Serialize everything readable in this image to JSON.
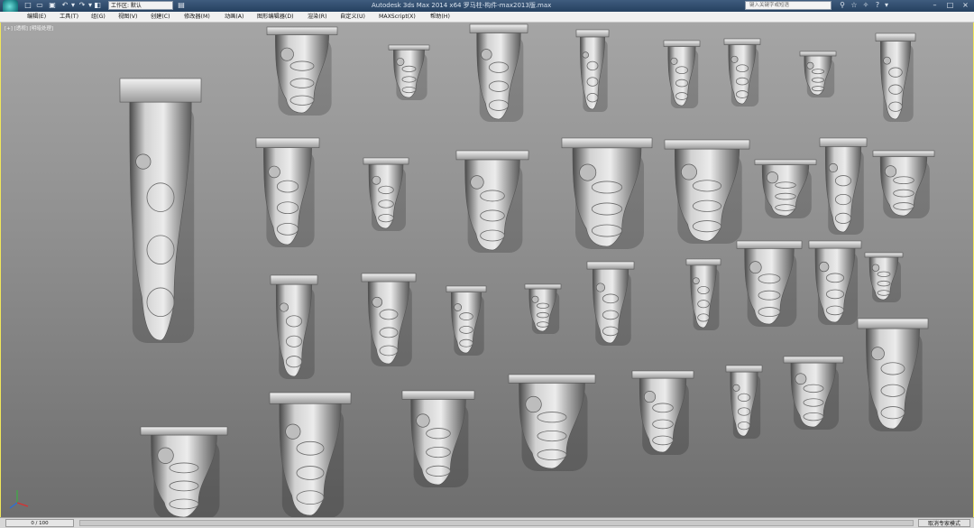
{
  "titlebar": {
    "title": "Autodesk 3ds Max  2014 x64     罗马柱-构件-max2013版.max",
    "workspace_label": "工作区: 默认",
    "search_placeholder": "键入关键字或短语",
    "quick_access_icons": [
      "new-file-icon",
      "open-folder-icon",
      "save-icon",
      "undo-icon",
      "undo-dropdown-icon",
      "redo-icon",
      "redo-dropdown-icon",
      "hold-icon",
      "project-folder-icon"
    ],
    "right_icons": [
      "binoculars-icon",
      "star-icon",
      "tools-icon",
      "help-circle-icon"
    ]
  },
  "menu": {
    "items": [
      "编辑(E)",
      "工具(T)",
      "组(G)",
      "视图(V)",
      "创建(C)",
      "修改器(M)",
      "动画(A)",
      "图形编辑器(D)",
      "渲染(R)",
      "自定义(U)",
      "MAXScript(X)",
      "帮助(H)"
    ]
  },
  "viewport": {
    "label": "[+] [透视] [明暗处理]",
    "border_color": "#f0e65a",
    "objects": {
      "count": 38,
      "type": "corbel-bracket"
    }
  },
  "status": {
    "frame_counter": "0 / 100",
    "action_text": "取消专家模式"
  },
  "colors": {
    "titlebar": "#2f4b6b",
    "menubar": "#f0f0f0",
    "viewport_top": "#a5a5a5",
    "viewport_bottom": "#6e6e6e"
  }
}
